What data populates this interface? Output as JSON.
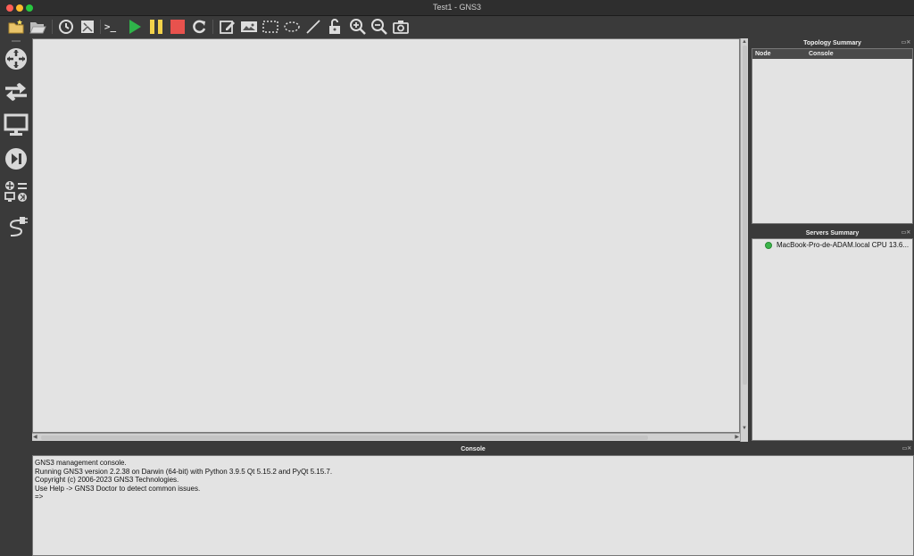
{
  "window": {
    "title": "Test1 - GNS3"
  },
  "toolbar": {
    "buttons": [
      "new-project-icon",
      "open-project-icon",
      "snapshot-icon",
      "show-interface-labels-icon",
      "console-all-icon",
      "start-all-icon",
      "pause-all-icon",
      "stop-all-icon",
      "reload-all-icon",
      "add-note-icon",
      "insert-image-icon",
      "draw-rectangle-icon",
      "draw-ellipse-icon",
      "draw-line-icon",
      "lock-unlock-icon",
      "zoom-in-icon",
      "zoom-out-icon",
      "screenshot-icon"
    ],
    "console_glyph": ">_",
    "colors": {
      "start": "#2fb34a",
      "pause": "#f2d24a",
      "stop": "#e8524d"
    }
  },
  "sidebar": {
    "items": [
      "routers-icon",
      "switches-icon",
      "end-devices-icon",
      "security-devices-icon",
      "all-devices-icon",
      "add-link-icon"
    ]
  },
  "topology_summary": {
    "title": "Topology Summary",
    "columns": [
      "Node",
      "Console"
    ]
  },
  "servers_summary": {
    "title": "Servers Summary",
    "servers": [
      {
        "name": "MacBook-Pro-de-ADAM.local CPU 13.6...",
        "status_color": "#3bb54a"
      }
    ]
  },
  "console": {
    "title": "Console",
    "lines": [
      "GNS3 management console.",
      "Running GNS3 version 2.2.38 on Darwin (64-bit) with Python 3.9.5 Qt 5.15.2 and PyQt 5.15.7.",
      "Copyright (c) 2006-2023 GNS3 Technologies.",
      "Use Help -> GNS3 Doctor to detect common issues.",
      "",
      "=>"
    ]
  }
}
